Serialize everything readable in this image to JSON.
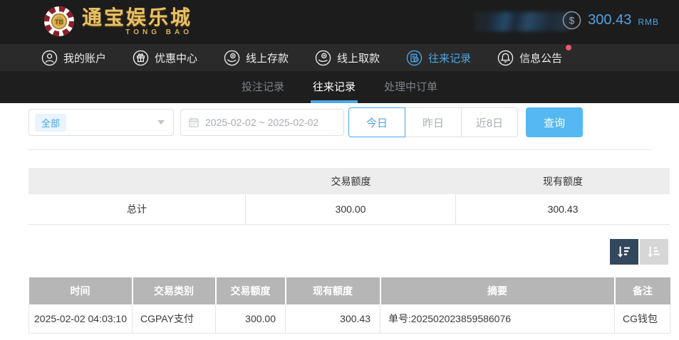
{
  "header": {
    "logo": {
      "chip_text": "TB",
      "title": "通宝娱乐城",
      "subtitle": "TONG BAO"
    },
    "balance": {
      "amount": "300.43",
      "currency": "RMB"
    }
  },
  "icons": {
    "dollar": "$"
  },
  "nav": {
    "items": [
      {
        "label": "我的账户",
        "icon": "user-icon",
        "active": false
      },
      {
        "label": "优惠中心",
        "icon": "gift-icon",
        "active": false
      },
      {
        "label": "线上存款",
        "icon": "deposit-icon",
        "active": false
      },
      {
        "label": "线上取款",
        "icon": "withdraw-icon",
        "active": false
      },
      {
        "label": "往来记录",
        "icon": "records-icon",
        "active": true
      },
      {
        "label": "信息公告",
        "icon": "bell-icon",
        "active": false,
        "badge_dot": true
      }
    ]
  },
  "subtabs": [
    {
      "label": "投注记录",
      "active": false
    },
    {
      "label": "往来记录",
      "active": true
    },
    {
      "label": "处理中订单",
      "active": false
    }
  ],
  "filters": {
    "type_select": {
      "value": "全部"
    },
    "date_range": {
      "value": "2025-02-02 ~ 2025-02-02"
    },
    "quick_ranges": [
      {
        "label": "今日",
        "active": true
      },
      {
        "label": "昨日",
        "active": false
      },
      {
        "label": "近8日",
        "active": false
      }
    ],
    "search_label": "查询"
  },
  "summary_table": {
    "headers": [
      "",
      "交易额度",
      "现有额度"
    ],
    "row": {
      "label": "总计",
      "transaction_amount": "300.00",
      "current_amount": "300.43"
    }
  },
  "records_table": {
    "headers": [
      "时间",
      "交易类别",
      "交易额度",
      "现有额度",
      "摘要",
      "备注"
    ],
    "rows": [
      {
        "time": "2025-02-02 04:03:10",
        "type": "CGPAY支付",
        "amount": "300.00",
        "balance": "300.43",
        "summary": "单号:202502023859586076",
        "note": "CG钱包"
      }
    ]
  },
  "colors": {
    "accent_blue": "#4da6e8",
    "search_button_blue": "#55b8f2",
    "balance_blue": "#4da3e8",
    "gold": "#e7c166",
    "notice_dot_red": "#e85868",
    "table_header_gray": "#b6b6b6",
    "summary_header_gray": "#ededed",
    "topbar_dark": "#1c1c1c",
    "nav_dark": "#2a2a2a",
    "sort_active_dark": "#33485c"
  }
}
